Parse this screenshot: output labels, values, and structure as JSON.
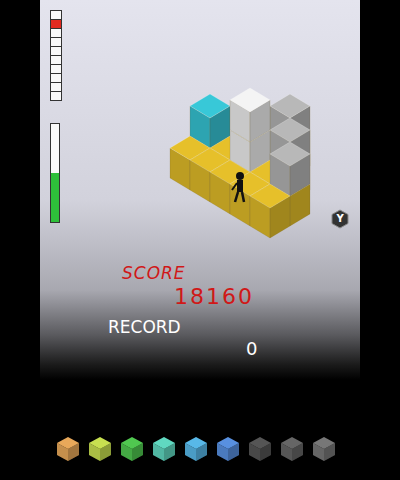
{
  "hud": {
    "danger_meter": {
      "segments": [
        {
          "on": false
        },
        {
          "on": true
        },
        {
          "on": false
        },
        {
          "on": false
        },
        {
          "on": false
        },
        {
          "on": false
        },
        {
          "on": false
        },
        {
          "on": false
        },
        {
          "on": false
        },
        {
          "on": false
        }
      ]
    },
    "health_bar": {
      "level": 0.5
    },
    "button_hint": "Y"
  },
  "scene": {
    "cubes": [
      {
        "color": "#e6c02a"
      },
      {
        "color": "#e6c02a"
      },
      {
        "color": "#e6c02a"
      },
      {
        "color": "#e6c02a"
      },
      {
        "color": "#e6c02a"
      },
      {
        "color": "#e6c02a"
      },
      {
        "color": "#e6c02a"
      },
      {
        "color": "#e6c02a"
      },
      {
        "color": "#e6c02a"
      },
      {
        "color": "#e6c02a"
      },
      {
        "color": "#e6c02a"
      },
      {
        "color": "#e6c02a"
      },
      {
        "color": "#e6c02a"
      },
      {
        "color": "#e6c02a"
      },
      {
        "color": "#b8b8b8"
      },
      {
        "color": "#b8b8b8"
      },
      {
        "color": "#b8b8b8"
      },
      {
        "color": "#38c8d8"
      },
      {
        "color": "#f4f4f4"
      },
      {
        "color": "#f4f4f4"
      }
    ]
  },
  "score": {
    "label": "SCORE",
    "value": "18160"
  },
  "record": {
    "label": "RECORD",
    "value": "0"
  },
  "palette": [
    {
      "color": "#e8a85a"
    },
    {
      "color": "#c8e050"
    },
    {
      "color": "#50c850"
    },
    {
      "color": "#60d8c0"
    },
    {
      "color": "#58b8e8"
    },
    {
      "color": "#5890e0"
    },
    {
      "color": "#555555"
    },
    {
      "color": "#666666"
    },
    {
      "color": "#777777"
    }
  ]
}
